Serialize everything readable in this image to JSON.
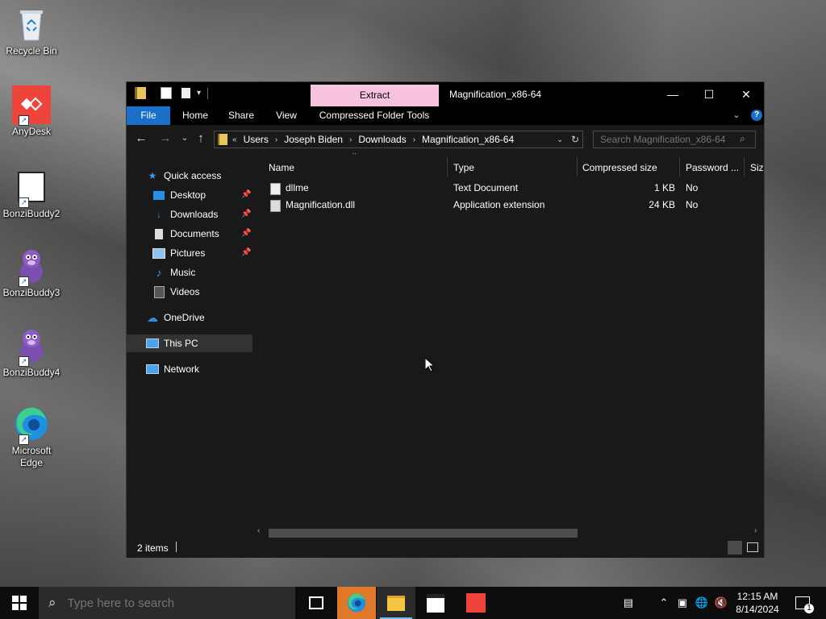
{
  "desktop": {
    "icons": [
      {
        "label": "Recycle Bin"
      },
      {
        "label": "AnyDesk"
      },
      {
        "label": "BonziBuddy2"
      },
      {
        "label": "BonziBuddy3"
      },
      {
        "label": "BonziBuddy4"
      },
      {
        "label": "Microsoft Edge"
      }
    ]
  },
  "window": {
    "title": "Magnification_x86-64",
    "context_tab": "Extract",
    "ribbon_tabs": [
      "File",
      "Home",
      "Share",
      "View",
      "Compressed Folder Tools"
    ],
    "breadcrumb": [
      "Users",
      "Joseph Biden",
      "Downloads",
      "Magnification_x86-64"
    ],
    "breadcrumb_overflow": "«",
    "search_placeholder": "Search Magnification_x86-64",
    "nav": {
      "quick_access": "Quick access",
      "pinned": [
        "Desktop",
        "Downloads",
        "Documents",
        "Pictures"
      ],
      "unpinned": [
        "Music",
        "Videos"
      ],
      "onedrive": "OneDrive",
      "this_pc": "This PC",
      "network": "Network"
    },
    "columns": [
      "Name",
      "Type",
      "Compressed size",
      "Password ...",
      "Size"
    ],
    "files": [
      {
        "name": "dllme",
        "type": "Text Document",
        "compressed_size": "1 KB",
        "password": "No"
      },
      {
        "name": "Magnification.dll",
        "type": "Application extension",
        "compressed_size": "24 KB",
        "password": "No"
      }
    ],
    "status": "2 items"
  },
  "taskbar": {
    "search_placeholder": "Type here to search",
    "time": "12:15 AM",
    "date": "8/14/2024",
    "notification_count": "1"
  },
  "colors": {
    "file_tab": "#1a6fc9",
    "context_tab": "#f7c3dc",
    "taskbar_active": "#76b9ed"
  }
}
